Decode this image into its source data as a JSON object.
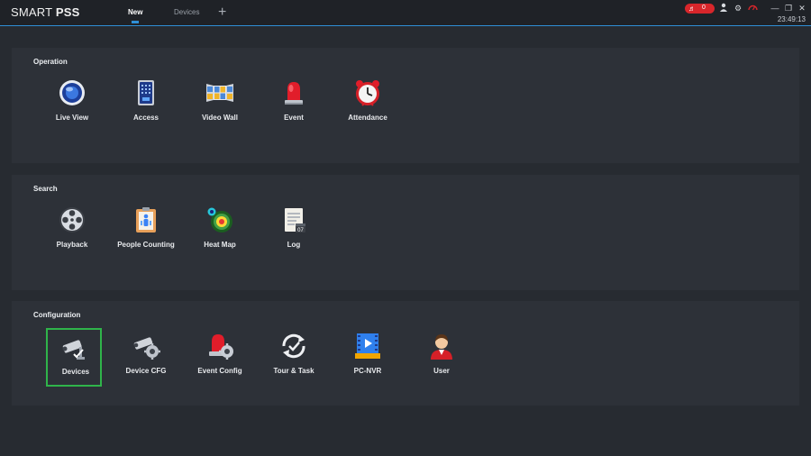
{
  "header": {
    "app_title_light": "SMART",
    "app_title_bold": "PSS",
    "tabs": [
      {
        "label": "New",
        "active": true
      },
      {
        "label": "Devices",
        "active": false
      }
    ],
    "add_tab_icon": "plus-icon",
    "alarm_count": "0",
    "icons": [
      "bell-icon",
      "user-icon",
      "gear-icon",
      "gauge-icon",
      "close-icon",
      "restore-icon"
    ],
    "clock": "23:49:13",
    "accent_color": "#2f8fd6",
    "alarm_color": "#d8262b"
  },
  "sections": [
    {
      "title": "Operation",
      "items": [
        {
          "label": "Live View",
          "icon": "live-view-icon"
        },
        {
          "label": "Access",
          "icon": "access-icon"
        },
        {
          "label": "Video Wall",
          "icon": "video-wall-icon"
        },
        {
          "label": "Event",
          "icon": "event-siren-icon"
        },
        {
          "label": "Attendance",
          "icon": "alarm-clock-icon"
        }
      ]
    },
    {
      "title": "Search",
      "items": [
        {
          "label": "Playback",
          "icon": "film-reel-icon"
        },
        {
          "label": "People Counting",
          "icon": "people-counting-icon"
        },
        {
          "label": "Heat Map",
          "icon": "heat-map-icon"
        },
        {
          "label": "Log",
          "icon": "log-icon"
        }
      ]
    },
    {
      "title": "Configuration",
      "items": [
        {
          "label": "Devices",
          "icon": "camera-check-icon",
          "selected": true
        },
        {
          "label": "Device CFG",
          "icon": "camera-gear-icon"
        },
        {
          "label": "Event Config",
          "icon": "siren-gear-icon"
        },
        {
          "label": "Tour & Task",
          "icon": "tour-task-icon"
        },
        {
          "label": "PC-NVR",
          "icon": "pc-nvr-icon"
        },
        {
          "label": "User",
          "icon": "user-avatar-icon"
        }
      ]
    }
  ],
  "selection_color": "#2fb44a"
}
